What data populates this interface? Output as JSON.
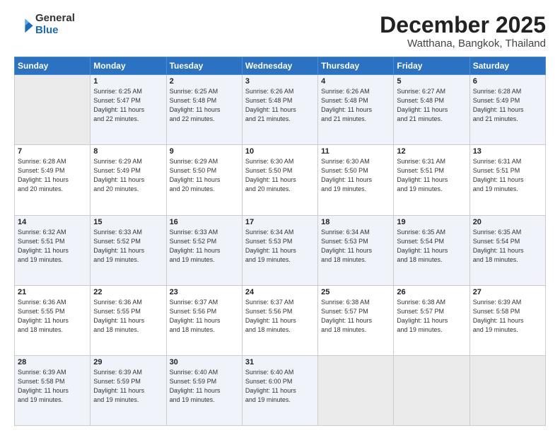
{
  "logo": {
    "general": "General",
    "blue": "Blue"
  },
  "title": "December 2025",
  "location": "Watthana, Bangkok, Thailand",
  "weekdays": [
    "Sunday",
    "Monday",
    "Tuesday",
    "Wednesday",
    "Thursday",
    "Friday",
    "Saturday"
  ],
  "weeks": [
    [
      {
        "day": "",
        "info": ""
      },
      {
        "day": "1",
        "info": "Sunrise: 6:25 AM\nSunset: 5:47 PM\nDaylight: 11 hours\nand 22 minutes."
      },
      {
        "day": "2",
        "info": "Sunrise: 6:25 AM\nSunset: 5:48 PM\nDaylight: 11 hours\nand 22 minutes."
      },
      {
        "day": "3",
        "info": "Sunrise: 6:26 AM\nSunset: 5:48 PM\nDaylight: 11 hours\nand 21 minutes."
      },
      {
        "day": "4",
        "info": "Sunrise: 6:26 AM\nSunset: 5:48 PM\nDaylight: 11 hours\nand 21 minutes."
      },
      {
        "day": "5",
        "info": "Sunrise: 6:27 AM\nSunset: 5:48 PM\nDaylight: 11 hours\nand 21 minutes."
      },
      {
        "day": "6",
        "info": "Sunrise: 6:28 AM\nSunset: 5:49 PM\nDaylight: 11 hours\nand 21 minutes."
      }
    ],
    [
      {
        "day": "7",
        "info": "Sunrise: 6:28 AM\nSunset: 5:49 PM\nDaylight: 11 hours\nand 20 minutes."
      },
      {
        "day": "8",
        "info": "Sunrise: 6:29 AM\nSunset: 5:49 PM\nDaylight: 11 hours\nand 20 minutes."
      },
      {
        "day": "9",
        "info": "Sunrise: 6:29 AM\nSunset: 5:50 PM\nDaylight: 11 hours\nand 20 minutes."
      },
      {
        "day": "10",
        "info": "Sunrise: 6:30 AM\nSunset: 5:50 PM\nDaylight: 11 hours\nand 20 minutes."
      },
      {
        "day": "11",
        "info": "Sunrise: 6:30 AM\nSunset: 5:50 PM\nDaylight: 11 hours\nand 19 minutes."
      },
      {
        "day": "12",
        "info": "Sunrise: 6:31 AM\nSunset: 5:51 PM\nDaylight: 11 hours\nand 19 minutes."
      },
      {
        "day": "13",
        "info": "Sunrise: 6:31 AM\nSunset: 5:51 PM\nDaylight: 11 hours\nand 19 minutes."
      }
    ],
    [
      {
        "day": "14",
        "info": "Sunrise: 6:32 AM\nSunset: 5:51 PM\nDaylight: 11 hours\nand 19 minutes."
      },
      {
        "day": "15",
        "info": "Sunrise: 6:33 AM\nSunset: 5:52 PM\nDaylight: 11 hours\nand 19 minutes."
      },
      {
        "day": "16",
        "info": "Sunrise: 6:33 AM\nSunset: 5:52 PM\nDaylight: 11 hours\nand 19 minutes."
      },
      {
        "day": "17",
        "info": "Sunrise: 6:34 AM\nSunset: 5:53 PM\nDaylight: 11 hours\nand 19 minutes."
      },
      {
        "day": "18",
        "info": "Sunrise: 6:34 AM\nSunset: 5:53 PM\nDaylight: 11 hours\nand 18 minutes."
      },
      {
        "day": "19",
        "info": "Sunrise: 6:35 AM\nSunset: 5:54 PM\nDaylight: 11 hours\nand 18 minutes."
      },
      {
        "day": "20",
        "info": "Sunrise: 6:35 AM\nSunset: 5:54 PM\nDaylight: 11 hours\nand 18 minutes."
      }
    ],
    [
      {
        "day": "21",
        "info": "Sunrise: 6:36 AM\nSunset: 5:55 PM\nDaylight: 11 hours\nand 18 minutes."
      },
      {
        "day": "22",
        "info": "Sunrise: 6:36 AM\nSunset: 5:55 PM\nDaylight: 11 hours\nand 18 minutes."
      },
      {
        "day": "23",
        "info": "Sunrise: 6:37 AM\nSunset: 5:56 PM\nDaylight: 11 hours\nand 18 minutes."
      },
      {
        "day": "24",
        "info": "Sunrise: 6:37 AM\nSunset: 5:56 PM\nDaylight: 11 hours\nand 18 minutes."
      },
      {
        "day": "25",
        "info": "Sunrise: 6:38 AM\nSunset: 5:57 PM\nDaylight: 11 hours\nand 18 minutes."
      },
      {
        "day": "26",
        "info": "Sunrise: 6:38 AM\nSunset: 5:57 PM\nDaylight: 11 hours\nand 19 minutes."
      },
      {
        "day": "27",
        "info": "Sunrise: 6:39 AM\nSunset: 5:58 PM\nDaylight: 11 hours\nand 19 minutes."
      }
    ],
    [
      {
        "day": "28",
        "info": "Sunrise: 6:39 AM\nSunset: 5:58 PM\nDaylight: 11 hours\nand 19 minutes."
      },
      {
        "day": "29",
        "info": "Sunrise: 6:39 AM\nSunset: 5:59 PM\nDaylight: 11 hours\nand 19 minutes."
      },
      {
        "day": "30",
        "info": "Sunrise: 6:40 AM\nSunset: 5:59 PM\nDaylight: 11 hours\nand 19 minutes."
      },
      {
        "day": "31",
        "info": "Sunrise: 6:40 AM\nSunset: 6:00 PM\nDaylight: 11 hours\nand 19 minutes."
      },
      {
        "day": "",
        "info": ""
      },
      {
        "day": "",
        "info": ""
      },
      {
        "day": "",
        "info": ""
      }
    ]
  ]
}
